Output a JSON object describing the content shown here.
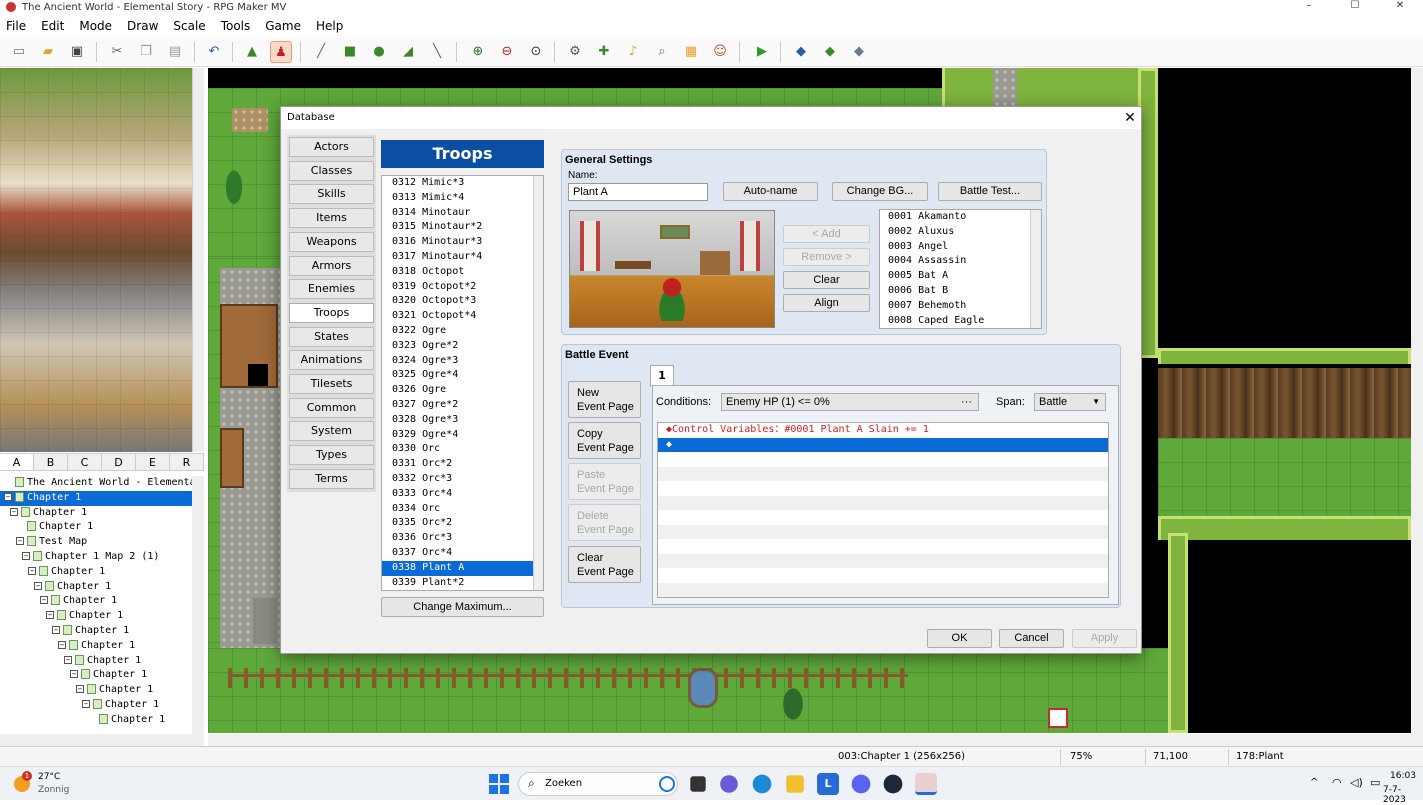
{
  "window": {
    "title": "The Ancient World - Elemental Story - RPG Maker MV",
    "minimize": "–",
    "maximize": "☐",
    "close": "✕"
  },
  "menu": [
    "File",
    "Edit",
    "Mode",
    "Draw",
    "Scale",
    "Tools",
    "Game",
    "Help"
  ],
  "tileset_tabs": [
    "A",
    "B",
    "C",
    "D",
    "E",
    "R"
  ],
  "map_tree": [
    {
      "label": "The Ancient World - Elemental Sto",
      "indent": 0,
      "exp": false,
      "root": true
    },
    {
      "label": "Chapter 1",
      "indent": 0,
      "exp": true,
      "sel": true
    },
    {
      "label": "Chapter 1",
      "indent": 1,
      "exp": true
    },
    {
      "label": "Chapter 1",
      "indent": 2,
      "exp": false
    },
    {
      "label": "Test Map",
      "indent": 2,
      "exp": true
    },
    {
      "label": "Chapter 1 Map 2 (1)",
      "indent": 3,
      "exp": true
    },
    {
      "label": "Chapter 1",
      "indent": 4,
      "exp": true
    },
    {
      "label": "Chapter 1",
      "indent": 5,
      "exp": true
    },
    {
      "label": "Chapter 1",
      "indent": 6,
      "exp": true
    },
    {
      "label": "Chapter 1",
      "indent": 7,
      "exp": true
    },
    {
      "label": "Chapter 1",
      "indent": 8,
      "exp": true
    },
    {
      "label": "Chapter 1",
      "indent": 9,
      "exp": true
    },
    {
      "label": "Chapter 1",
      "indent": 10,
      "exp": true
    },
    {
      "label": "Chapter 1",
      "indent": 11,
      "exp": true
    },
    {
      "label": "Chapter 1",
      "indent": 12,
      "exp": true
    },
    {
      "label": "Chapter 1",
      "indent": 13,
      "exp": true
    },
    {
      "label": "Chapter 1",
      "indent": 14,
      "exp": false
    }
  ],
  "statusbar": {
    "map": "003:Chapter 1 (256x256)",
    "zoom": "75%",
    "coords": "71,100",
    "tile": "178:Plant"
  },
  "taskbar": {
    "temp": "27°C",
    "weather": "Zonnig",
    "badge": "1",
    "search": "Zoeken",
    "time": "16:03",
    "date": "7-7-2023"
  },
  "dialog": {
    "title": "Database",
    "categories": [
      "Actors",
      "Classes",
      "Skills",
      "Items",
      "Weapons",
      "Armors",
      "Enemies",
      "Troops",
      "States",
      "Animations",
      "Tilesets",
      "Common Events",
      "System",
      "Types",
      "Terms"
    ],
    "selected_category": "Troops",
    "header": "Troops",
    "troops": [
      "0312 Mimic*3",
      "0313 Mimic*4",
      "0314 Minotaur",
      "0315 Minotaur*2",
      "0316 Minotaur*3",
      "0317 Minotaur*4",
      "0318 Octopot",
      "0319 Octopot*2",
      "0320 Octopot*3",
      "0321 Octopot*4",
      "0322 Ogre",
      "0323 Ogre*2",
      "0324 Ogre*3",
      "0325 Ogre*4",
      "0326 Ogre",
      "0327 Ogre*2",
      "0328 Ogre*3",
      "0329 Ogre*4",
      "0330 Orc",
      "0331 Orc*2",
      "0332 Orc*3",
      "0333 Orc*4",
      "0334 Orc",
      "0335 Orc*2",
      "0336 Orc*3",
      "0337 Orc*4",
      "0338 Plant A",
      "0339 Plant*2"
    ],
    "selected_troop": "0338 Plant A",
    "change_max": "Change Maximum...",
    "general": {
      "title": "General Settings",
      "name_label": "Name:",
      "name_value": "Plant A",
      "autoname": "Auto-name",
      "change_bg": "Change BG...",
      "battle_test": "Battle Test...",
      "add": "< Add",
      "remove": "Remove >",
      "clear": "Clear",
      "align": "Align"
    },
    "enemies": [
      "0001 Akamanto",
      "0002 Aluxus",
      "0003 Angel",
      "0004 Assassin",
      "0005 Bat A",
      "0006 Bat B",
      "0007 Behemoth",
      "0008 Caped Eagle"
    ],
    "battle_event": {
      "title": "Battle Event",
      "page_tab": "1",
      "conditions_label": "Conditions:",
      "conditions_value": "Enemy HP (1) <= 0%",
      "span_label": "Span:",
      "span_value": "Battle",
      "new_page": [
        "New",
        "Event Page"
      ],
      "copy_page": [
        "Copy",
        "Event Page"
      ],
      "paste_page": [
        "Paste",
        "Event Page"
      ],
      "delete_page": [
        "Delete",
        "Event Page"
      ],
      "clear_page": [
        "Clear",
        "Event Page"
      ],
      "command": "◆Control Variables：#0001 Plant A Slain += 1",
      "empty_cmd": "◆"
    },
    "ok": "OK",
    "cancel": "Cancel",
    "apply": "Apply"
  }
}
